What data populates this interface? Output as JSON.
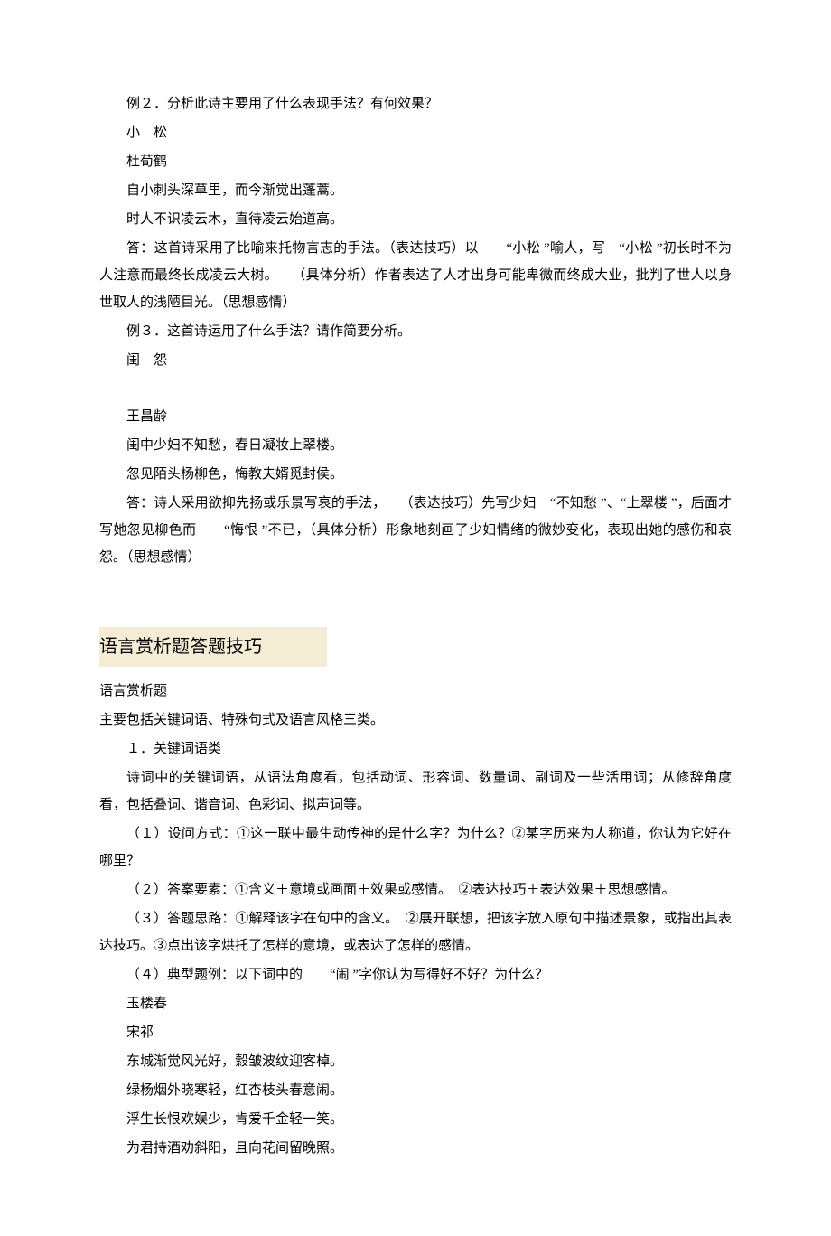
{
  "block1": {
    "p1": "例２．分析此诗主要用了什么表现手法？有何效果？",
    "p2": "小　松",
    "p3": "杜荀鹤",
    "p4": "自小刺头深草里，而今渐觉出蓬蒿。",
    "p5": "时人不识凌云木，直待凌云始道高。",
    "p6": "答：这首诗采用了比喻来托物言志的手法。（表达技巧）以　　“小松 ”喻人，写　“小松 ”初长时不为人注意而最终长成凌云大树。　　（具体分析）作者表达了人才出身可能卑微而终成大业，批判了世人以身世取人的浅陋目光。（思想感情）",
    "p7": "例３．这首诗运用了什么手法？请作简要分析。",
    "p8": "闺　怨"
  },
  "block2": {
    "p1": "王昌龄",
    "p2": "闺中少妇不知愁，春日凝妆上翠楼。",
    "p3": "忽见陌头杨柳色，悔教夫婿觅封侯。",
    "p4": "答：诗人采用欲抑先扬或乐景写哀的手法，　　（表达技巧）先写少妇　“不知愁 ”、“上翠楼 ”，后面才写她忽见柳色而　　“悔恨 ”不已，（具体分析）形象地刻画了少妇情绪的微妙变化，表现出她的感伤和哀怨。（思想感情）"
  },
  "section_title": "语言赏析题答题技巧",
  "block3": {
    "p1": "语言赏析题",
    "p2": "主要包括关键词语、特殊句式及语言风格三类。",
    "p3": "１．关键词语类",
    "p4": "诗词中的关键词语，从语法角度看，包括动词、形容词、数量词、副词及一些活用词；从修辞角度看，包括叠词、谐音词、色彩词、拟声词等。",
    "p5": "（１）设问方式：①这一联中最生动传神的是什么字？为什么？②某字历来为人称道，你认为它好在哪里？",
    "p6": "（２）答案要素：①含义＋意境或画面＋效果或感情。　②表达技巧＋表达效果＋思想感情。",
    "p7": "（３）答题思路：①解释该字在句中的含义。　②展开联想，把该字放入原句中描述景象，或指出其表达技巧。③点出该字烘托了怎样的意境，或表达了怎样的感情。",
    "p8": "（４）典型题例：以下词中的　　“闹 ”字你认为写得好不好？为什么？",
    "p9": "玉楼春",
    "p10": "宋祁",
    "p11": "东城渐觉风光好，縠皱波纹迎客棹。",
    "p12": "绿杨烟外晓寒轻，红杏枝头春意闹。",
    "p13": "浮生长恨欢娱少，肯爱千金轻一笑。",
    "p14": "为君持酒劝斜阳，且向花间留晚照。"
  }
}
